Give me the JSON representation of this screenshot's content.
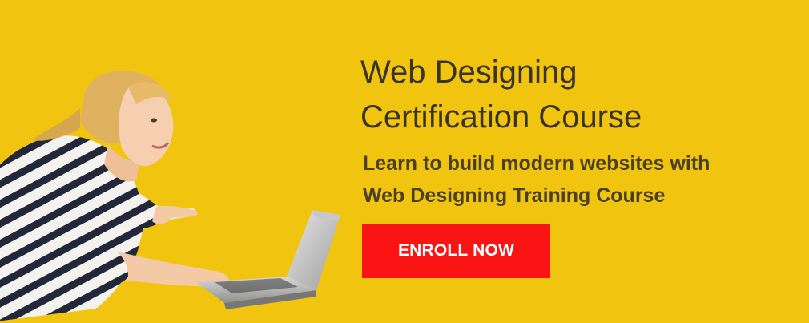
{
  "banner": {
    "title_line1": "Web Designing",
    "title_line2": "Certification Course",
    "subtitle_line1": "Learn to build modern websites with",
    "subtitle_line2": "Web Designing Training Course",
    "cta_label": "ENROLL NOW"
  },
  "colors": {
    "background": "#f1c40f",
    "heading_text": "#3a3328",
    "subtitle_text": "#4a4026",
    "cta_background": "#fb1414",
    "cta_text": "#ffffff"
  },
  "icons": {
    "illustration": "woman-with-laptop-illustration"
  }
}
